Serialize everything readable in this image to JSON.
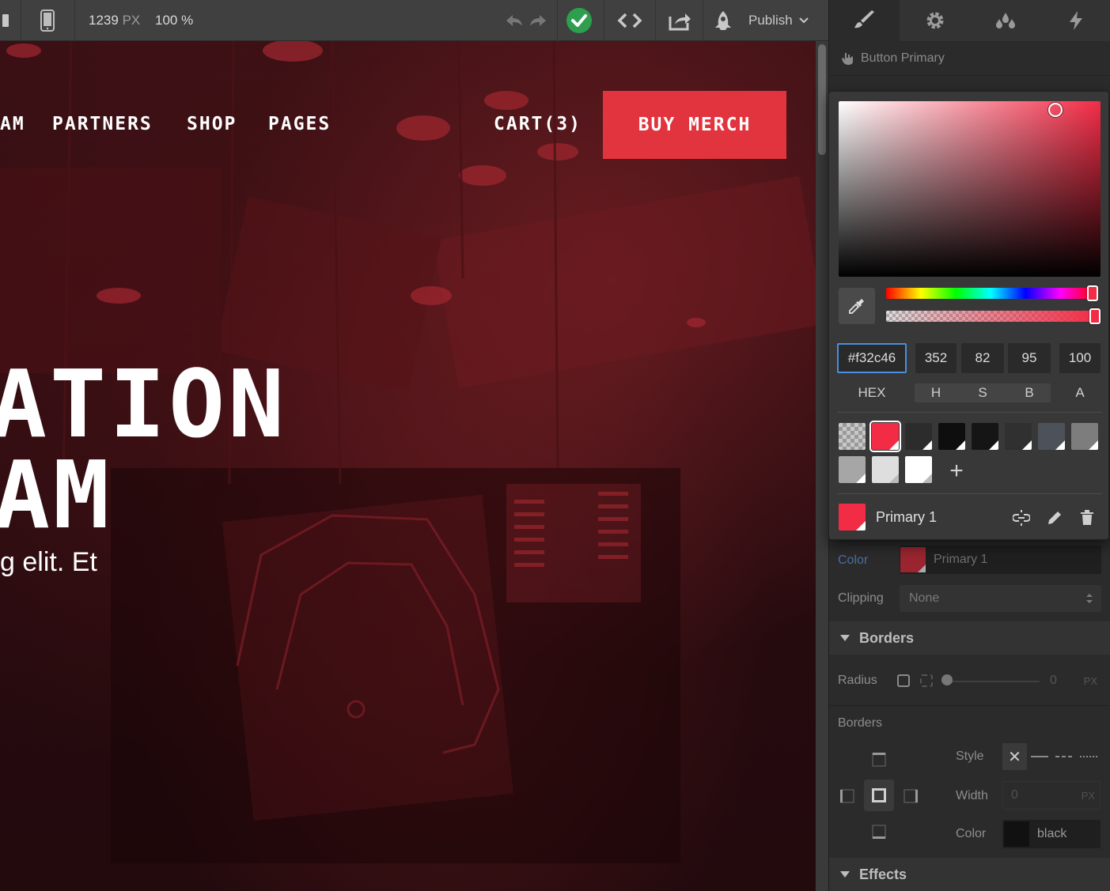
{
  "toolbar": {
    "width_value": "1239",
    "width_unit": "PX",
    "zoom": "100 %",
    "publish_label": "Publish"
  },
  "canvas": {
    "nav": [
      "AM",
      "PARTNERS",
      "SHOP",
      "PAGES"
    ],
    "cart_label": "CART(3)",
    "buy_button": "BUY MERCH",
    "hero_line1": "ATION",
    "hero_line2": "AM",
    "hero_sub": "g elit. Et"
  },
  "panel": {
    "selected_element": "Button Primary",
    "color_label": "Color",
    "color_value": "Primary 1",
    "clipping_label": "Clipping",
    "clipping_value": "None",
    "borders_section": "Borders",
    "radius_label": "Radius",
    "radius_value": "0",
    "radius_unit": "PX",
    "borders_label": "Borders",
    "style_label": "Style",
    "width_label": "Width",
    "width_value": "0",
    "width_unit": "PX",
    "border_color_label": "Color",
    "border_color_value": "black",
    "effects_section": "Effects"
  },
  "picker": {
    "hex": "#f32c46",
    "h": "352",
    "s": "82",
    "b": "95",
    "a": "100",
    "labels": {
      "hex": "HEX",
      "h": "H",
      "s": "S",
      "b": "B",
      "a": "A"
    },
    "swatch_name": "Primary 1",
    "add_label": "+"
  },
  "colors": {
    "accent": "#f32c46",
    "button": "#e2343e",
    "selection_blue": "#4a8fe0",
    "publish_green": "#2e9e4f"
  }
}
